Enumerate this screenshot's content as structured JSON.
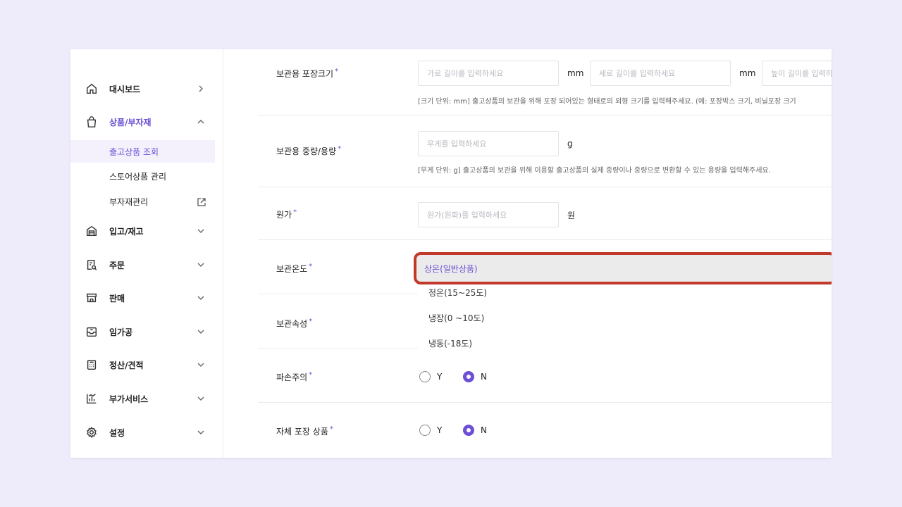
{
  "sidebar": {
    "items": [
      {
        "label": "대시보드",
        "icon": "home-icon",
        "chevron": "chevron-right-icon"
      },
      {
        "label": "상품/부자재",
        "icon": "shopping-bag-icon",
        "chevron": "chevron-up-icon"
      },
      {
        "label": "입고/재고",
        "icon": "warehouse-icon",
        "chevron": "chevron-down-icon"
      },
      {
        "label": "주문",
        "icon": "order-document-icon",
        "chevron": "chevron-down-icon"
      },
      {
        "label": "판매",
        "icon": "store-icon",
        "chevron": "chevron-down-icon"
      },
      {
        "label": "임가공",
        "icon": "processing-tray-icon",
        "chevron": "chevron-down-icon"
      },
      {
        "label": "정산/견적",
        "icon": "calculator-icon",
        "chevron": "chevron-down-icon"
      },
      {
        "label": "부가서비스",
        "icon": "chart-icon",
        "chevron": "chevron-down-icon"
      },
      {
        "label": "설정",
        "icon": "gear-icon",
        "chevron": "chevron-down-icon"
      }
    ],
    "subitems": [
      {
        "label": "출고상품 조회",
        "active": true
      },
      {
        "label": "스토어상품 관리",
        "active": false
      },
      {
        "label": "부자재관리",
        "active": false,
        "icon": "external-link-icon"
      }
    ]
  },
  "form": {
    "package_size": {
      "label": "보관용 포장크기",
      "required": "*",
      "width_placeholder": "가로 길이를 입력하세요",
      "length_placeholder": "세로 길이를 입력하세요",
      "height_placeholder": "높이 길이를 입력하세요",
      "unit": "mm",
      "hint": "[크기 단위: mm] 출고상품의 보관을 위해 포장 되어있는 형태로의 외형 크기를 입력해주세요. (예: 포장박스 크기, 비닐포장 크기"
    },
    "weight": {
      "label": "보관용 중량/용량",
      "required": "*",
      "placeholder": "무게를 입력하세요",
      "unit": "g",
      "hint": "[무게 단위: g] 출고상품의 보관을 위해 이용할 출고상품의 실제 중량이나 중량으로 변환할 수 있는 용량을 입력해주세요."
    },
    "cost": {
      "label": "원가",
      "required": "*",
      "placeholder": "원가(원화)를 입력하세요",
      "unit": "원"
    },
    "temperature": {
      "label": "보관온도",
      "required": "*",
      "selected": "상온(일반상품)",
      "options": [
        "정온(15~25도)",
        "냉장(0 ~10도)",
        "냉동(-18도)"
      ]
    },
    "attribute": {
      "label": "보관속성",
      "required": "*"
    },
    "fragile": {
      "label": "파손주의",
      "required": "*",
      "yes": "Y",
      "no": "N",
      "value": "N"
    },
    "self_packaging": {
      "label": "자체 포장 상품",
      "required": "*",
      "yes": "Y",
      "no": "N",
      "value": "N"
    }
  },
  "colors": {
    "accent": "#6c4fd4",
    "highlight_border": "#c0392b",
    "background": "#eeebfb"
  }
}
